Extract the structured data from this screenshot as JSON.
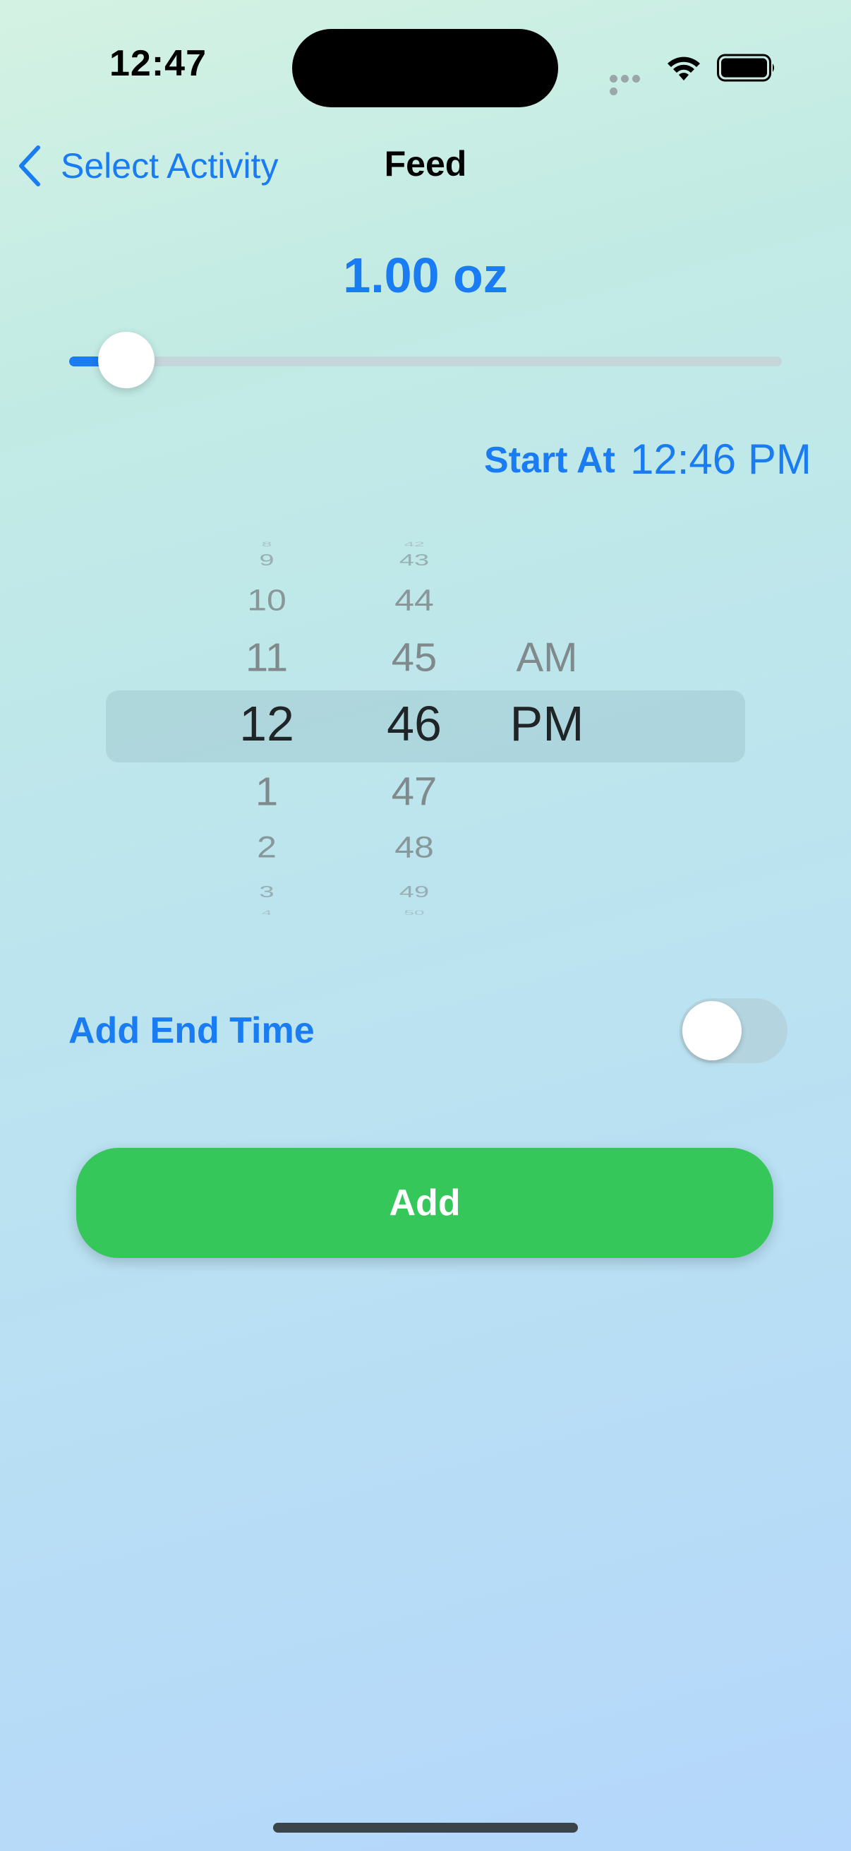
{
  "status_bar": {
    "time": "12:47",
    "icons": [
      "signal-dots-icon",
      "wifi-icon",
      "battery-icon"
    ]
  },
  "nav": {
    "back_label": "Select Activity",
    "title": "Feed"
  },
  "amount": {
    "value_text": "1.00 oz",
    "slider_fraction": 0.08
  },
  "start_at": {
    "label": "Start At",
    "value": "12:46 PM"
  },
  "picker": {
    "hours": [
      "8",
      "9",
      "10",
      "11",
      "12",
      "1",
      "2",
      "3",
      "4"
    ],
    "minutes": [
      "42",
      "43",
      "44",
      "45",
      "46",
      "47",
      "48",
      "49",
      "50"
    ],
    "periods": [
      "AM",
      "PM"
    ],
    "selected": {
      "hour": "12",
      "minute": "46",
      "period": "PM"
    }
  },
  "end_time": {
    "label": "Add End Time",
    "enabled": false
  },
  "add_button": {
    "label": "Add"
  },
  "colors": {
    "accent": "#1a7cf2",
    "add_button": "#35c759"
  }
}
